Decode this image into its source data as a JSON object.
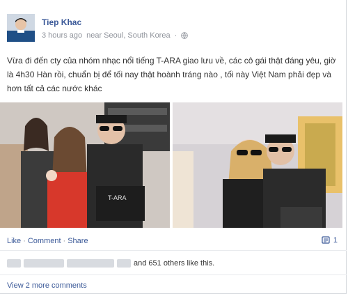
{
  "post": {
    "author": "Tiep Khac",
    "time": "3 hours ago",
    "location": "near Seoul, South Korea",
    "separator": "·",
    "text": "Vừa đi đến cty của nhóm nhạc nổi tiếng T-ARA giao lưu về, các cô gái thật đáng yêu, giờ là 4h30 Hàn rồi, chuẩn bị để tối nay thật hoành tráng nào , tối này Việt Nam phải đẹp và hơn tất cả các nước khác",
    "photo_caption_album": "T-ARA"
  },
  "actions": {
    "like": "Like",
    "comment": "Comment",
    "share": "Share",
    "dot": "·",
    "comment_count": "1"
  },
  "likes": {
    "text": "and 651 others like this."
  },
  "comments": {
    "view_more": "View 2 more comments"
  },
  "colors": {
    "link": "#3b5998",
    "meta": "#90949c",
    "divider": "#e9ebee"
  }
}
